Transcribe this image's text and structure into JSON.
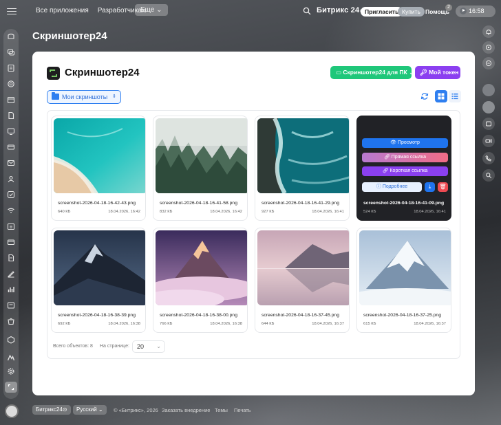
{
  "topbar": {
    "nav": [
      "Все приложения",
      "Разработчикам"
    ],
    "more": "Еще",
    "brand": "Битрикс 24",
    "invite": "Пригласить",
    "buy": "Купить",
    "help": "Помощь",
    "help_badge": "2",
    "time": "16:58"
  },
  "page": {
    "title": "Скриншотер24"
  },
  "app": {
    "name": "Скриншотер24",
    "pc_button": "Скриншотер24 для ПК",
    "token_button": "Мой токен",
    "folder": "Мои скриншоты"
  },
  "screenshots": [
    {
      "name": "screenshot-2026-04-18-16-42-43.png",
      "size": "640 КБ",
      "date": "18.04.2026, 16:42"
    },
    {
      "name": "screenshot-2026-04-18-16-41-58.png",
      "size": "832 КБ",
      "date": "18.04.2026, 16:42"
    },
    {
      "name": "screenshot-2026-04-18-16-41-29.png",
      "size": "927 КБ",
      "date": "18.04.2026, 16:41"
    },
    {
      "name": "screenshot-2026-04-18-16-41-09.png",
      "size": "524 КБ",
      "date": "18.04.2026, 16:41"
    },
    {
      "name": "screenshot-2026-04-18-16-38-39.png",
      "size": "692 КБ",
      "date": "18.04.2026, 16:38"
    },
    {
      "name": "screenshot-2026-04-18-16-38-00.png",
      "size": "766 КБ",
      "date": "18.04.2026, 16:38"
    },
    {
      "name": "screenshot-2026-04-18-16-37-45.png",
      "size": "644 КБ",
      "date": "18.04.2026, 16:37"
    },
    {
      "name": "screenshot-2026-04-18-16-37-25.png",
      "size": "615 КБ",
      "date": "18.04.2026, 16:37"
    }
  ],
  "overlay": {
    "view": "Просмотр",
    "direct_link": "Прямая ссылка",
    "short_link": "Короткая ссылка",
    "details": "Подробнее"
  },
  "pagination": {
    "total": "Всего объектов: 8",
    "per_page_label": "На странице:",
    "per_page_value": "20"
  },
  "footer": {
    "brand": "Битрикс24",
    "language": "Русский",
    "copyright": "© «Битрикс», 2026",
    "order": "Заказать внедрение",
    "themes": "Темы",
    "print": "Печать"
  },
  "colors": {
    "accent_blue": "#1f74ee",
    "green": "#1fc77a",
    "purple": "#8b3ff0",
    "red": "#ee4a52"
  }
}
